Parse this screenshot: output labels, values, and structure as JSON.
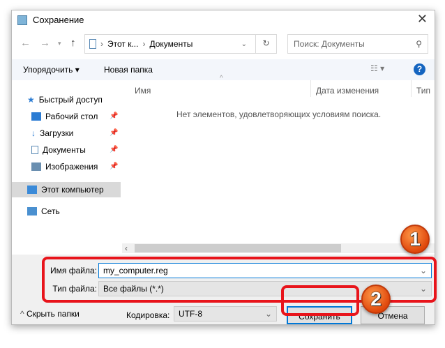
{
  "window": {
    "title": "Сохранение"
  },
  "address": {
    "segments": [
      "Этот к...",
      "Документы"
    ],
    "search_placeholder": "Поиск: Документы"
  },
  "toolbar": {
    "organize": "Упорядочить ▾",
    "new_folder": "Новая папка"
  },
  "sidebar": {
    "quick_access": "Быстрый доступ",
    "items": [
      "Рабочий стол",
      "Загрузки",
      "Документы",
      "Изображения"
    ],
    "this_pc": "Этот компьютер",
    "network": "Сеть"
  },
  "columns": {
    "name": "Имя",
    "date": "Дата изменения",
    "type": "Тип"
  },
  "empty_message": "Нет элементов, удовлетворяющих условиям поиска.",
  "form": {
    "filename_label": "Имя файла:",
    "filename_value": "my_computer.reg",
    "filetype_label": "Тип файла:",
    "filetype_value": "Все файлы  (*.*)",
    "encoding_label": "Кодировка:",
    "encoding_value": "UTF-8"
  },
  "buttons": {
    "hide_folders": "Скрыть папки",
    "save": "Сохранить",
    "cancel": "Отмена"
  },
  "badges": [
    "1",
    "2"
  ]
}
